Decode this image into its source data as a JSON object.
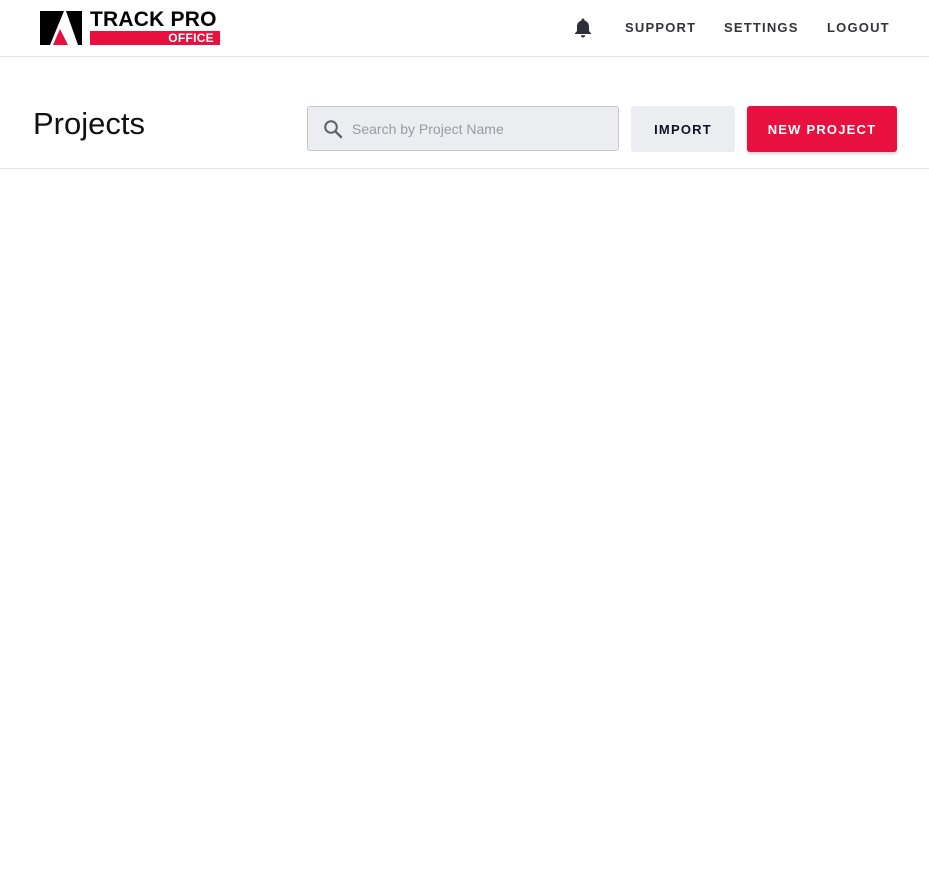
{
  "brand": {
    "name": "TRACK PRO",
    "subtitle": "OFFICE",
    "accent_color": "#e8103f"
  },
  "nav": {
    "notifications_icon": "bell-icon",
    "support_label": "SUPPORT",
    "settings_label": "SETTINGS",
    "logout_label": "LOGOUT"
  },
  "page": {
    "title": "Projects"
  },
  "search": {
    "icon": "search-icon",
    "placeholder": "Search by Project Name",
    "value": ""
  },
  "actions": {
    "import_label": "IMPORT",
    "new_project_label": "NEW PROJECT"
  }
}
